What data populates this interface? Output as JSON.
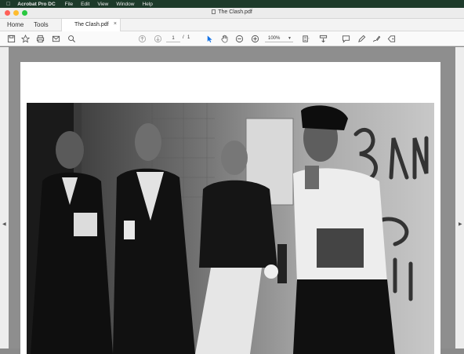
{
  "menubar": {
    "app": "Acrobat Pro DC",
    "items": [
      "File",
      "Edit",
      "View",
      "Window",
      "Help"
    ]
  },
  "window": {
    "title": "The Clash.pdf"
  },
  "tabs": {
    "home": "Home",
    "tools": "Tools",
    "document": "The Clash.pdf",
    "close": "×"
  },
  "toolbar": {
    "page_current": "1",
    "page_sep": "/",
    "page_total": "1",
    "zoom": "100%"
  },
  "colors": {
    "menubar_bg": "#1d3a2a",
    "light_red": "#ff5f57",
    "light_yellow": "#febc2e",
    "light_green": "#28c840",
    "accent_blue": "#1473e6"
  }
}
